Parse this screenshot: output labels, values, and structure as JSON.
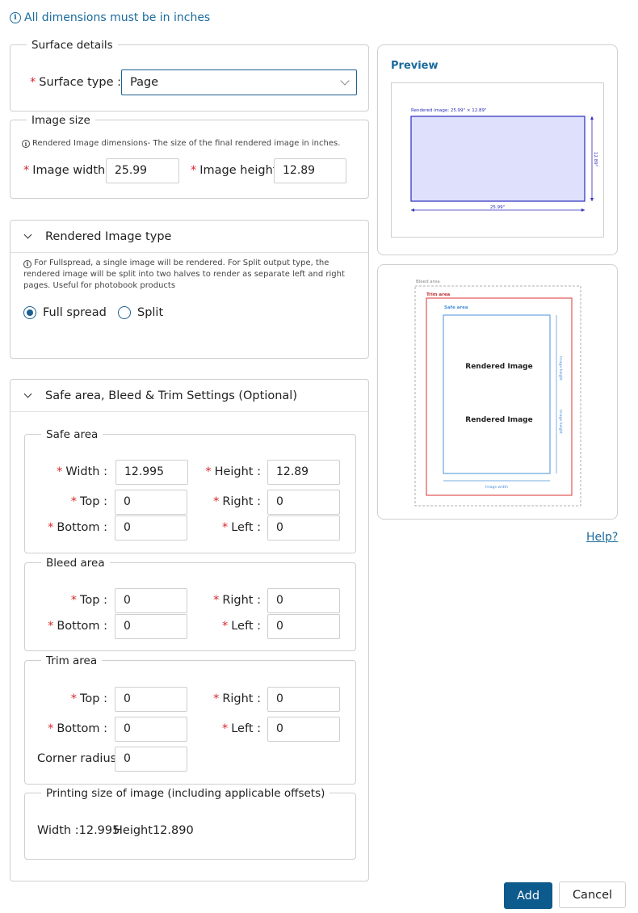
{
  "notice": "All dimensions must be in inches",
  "surface": {
    "legend": "Surface details",
    "type_label": "Surface type :",
    "type_value": "Page"
  },
  "image_size": {
    "legend": "Image size",
    "note": "Rendered Image dimensions- The size of the final rendered image in inches.",
    "width_label": "Image width :",
    "width_value": "25.99",
    "height_label": "Image height",
    "height_value": "12.89"
  },
  "render_type": {
    "title": "Rendered Image type",
    "note": "For Fullspread, a single image will be rendered. For Split output type, the rendered image will be split into two halves to render as separate left and right pages. Useful for photobook products",
    "options": [
      "Full spread",
      "Split"
    ],
    "selected": "Full spread"
  },
  "settings": {
    "title": "Safe area, Bleed & Trim Settings (Optional)",
    "safe": {
      "legend": "Safe area",
      "width_label": "Width :",
      "width_value": "12.995",
      "height_label": "Height :",
      "height_value": "12.89",
      "top_label": "Top :",
      "top_value": "0",
      "right_label": "Right :",
      "right_value": "0",
      "bottom_label": "Bottom :",
      "bottom_value": "0",
      "left_label": "Left :",
      "left_value": "0"
    },
    "bleed": {
      "legend": "Bleed area",
      "top_label": "Top :",
      "top_value": "0",
      "right_label": "Right :",
      "right_value": "0",
      "bottom_label": "Bottom :",
      "bottom_value": "0",
      "left_label": "Left :",
      "left_value": "0"
    },
    "trim": {
      "legend": "Trim area",
      "top_label": "Top :",
      "top_value": "0",
      "right_label": "Right :",
      "right_value": "0",
      "bottom_label": "Bottom :",
      "bottom_value": "0",
      "left_label": "Left :",
      "left_value": "0",
      "corner_label": "Corner radius",
      "corner_value": "0"
    },
    "printing": {
      "legend": "Printing size of image (including applicable offsets)",
      "width_label": "Width :",
      "width_value": "12.995",
      "height_label": "Height",
      "height_value": "12.890"
    }
  },
  "preview": {
    "title": "Preview",
    "caption": "Rendered image: 25.99\" × 12.89\"",
    "width_dim": "25.99\"",
    "height_dim": "12.89\""
  },
  "diagram": {
    "bleed_label": "Bleed area",
    "trim_label": "Trim area",
    "safe_label": "Safe area",
    "rendered_label": "Rendered Image",
    "image_width_label": "Image width",
    "image_height_label": "Image height"
  },
  "help": "Help?",
  "buttons": {
    "add": "Add",
    "cancel": "Cancel"
  },
  "colors": {
    "accent": "#0d5a8c",
    "link": "#1a6a9c",
    "required": "#d9262b",
    "trim": "#e05555",
    "safe": "#4a90d9",
    "render_fill": "#dfe0fb",
    "render_stroke": "#2b2bbd"
  }
}
